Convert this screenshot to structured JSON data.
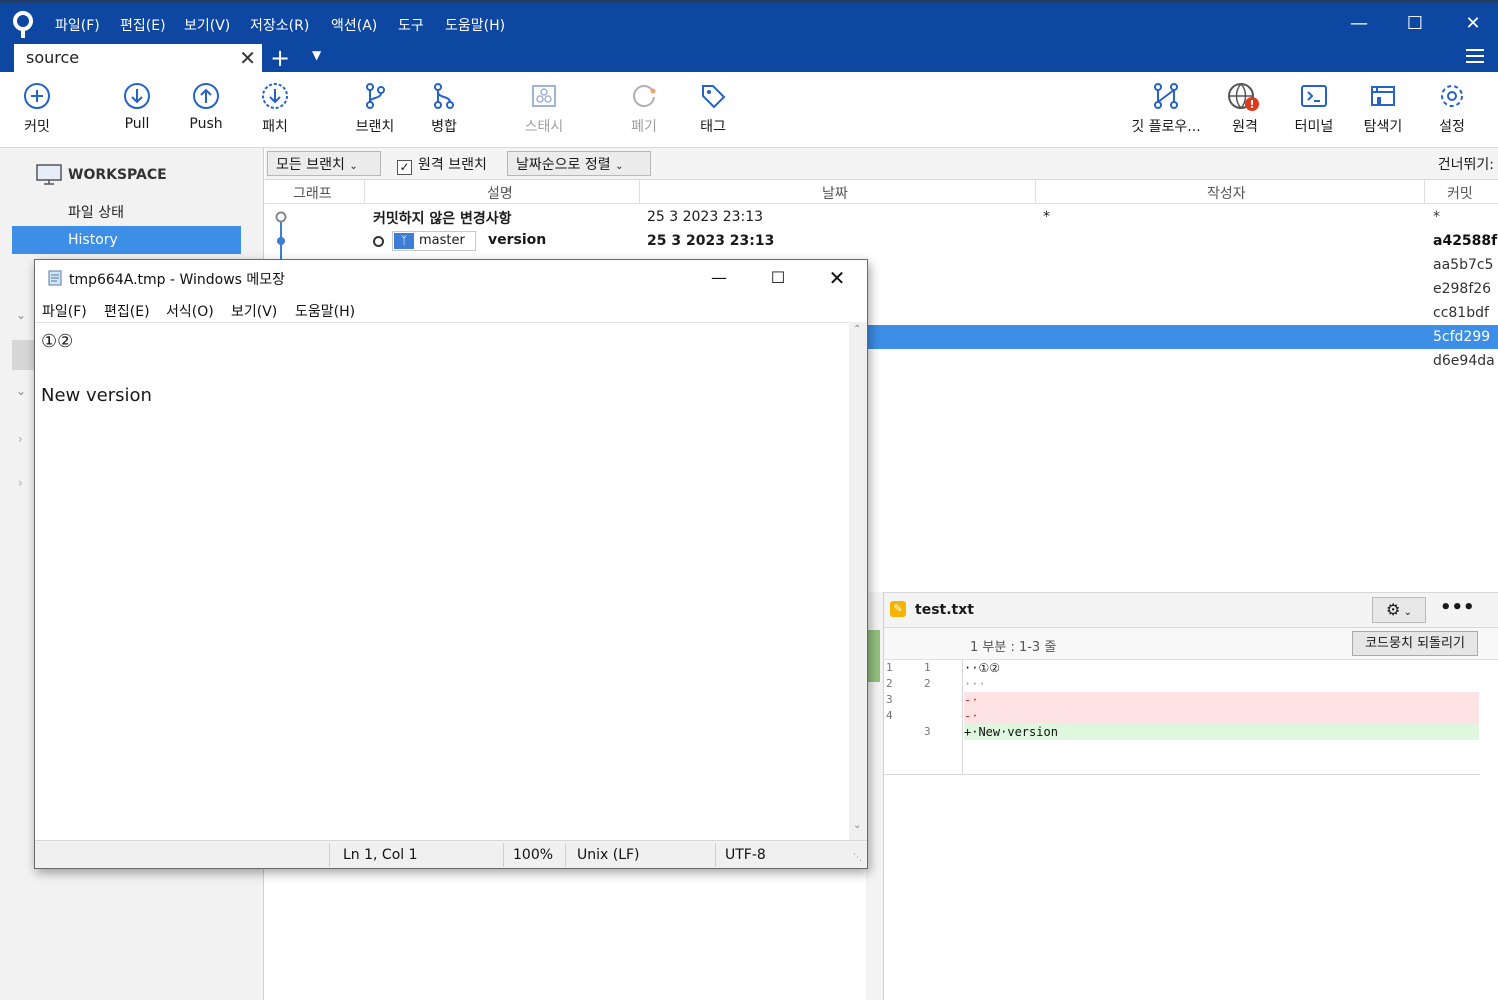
{
  "titlebar": {
    "menu": [
      "파일(F)",
      "편집(E)",
      "보기(V)",
      "저장소(R)",
      "액션(A)",
      "도구",
      "도움말(H)"
    ],
    "bg": "#0d47a1"
  },
  "tab": {
    "label": "source"
  },
  "toolbar": {
    "commit": "커밋",
    "pull": "Pull",
    "push": "Push",
    "patch": "패치",
    "branch": "브랜치",
    "merge": "병합",
    "stash": "스태시",
    "discard": "폐기",
    "tag": "태그",
    "gitflow": "깃 플로우...",
    "remote": "원격",
    "terminal": "터미널",
    "explorer": "탐색기",
    "settings": "설정"
  },
  "sidebar": {
    "workspace": "WORKSPACE",
    "file_status": "파일 상태",
    "history": "History"
  },
  "logbar": {
    "branches": "모든 브랜치",
    "remote_branches": "원격 브랜치",
    "sort": "날짜순으로 정렬",
    "skip": "건너뛰기:"
  },
  "columns": {
    "graph": "그래프",
    "description": "설명",
    "date": "날짜",
    "author": "작성자",
    "commit": "커밋"
  },
  "rows": {
    "uncommitted": {
      "desc": "커밋하지 않은 변경사항",
      "date": "25 3 2023 23:13",
      "author": "*",
      "commit": "*"
    },
    "head": {
      "branch": "master",
      "desc": "version",
      "date": "25 3 2023 23:13",
      "commit": "a42588f"
    },
    "hashes": [
      "aa5b7c5",
      "e298f26",
      "cc81bdf",
      "5cfd299",
      "d6e94da"
    ]
  },
  "diff": {
    "file": "test.txt",
    "hunk": "1 부분 : 1-3 줄",
    "revert": "코드뭉치 되돌리기",
    "lines": [
      {
        "old": "1",
        "new": "1",
        "text": "··①②",
        "type": "ctx"
      },
      {
        "old": "2",
        "new": "2",
        "text": "···",
        "type": "ctx"
      },
      {
        "old": "3",
        "new": "",
        "text": "-·",
        "type": "del"
      },
      {
        "old": "4",
        "new": "",
        "text": "-·",
        "type": "del"
      },
      {
        "old": "",
        "new": "3",
        "text": "+·New·version",
        "type": "add"
      }
    ]
  },
  "notepad": {
    "title": "tmp664A.tmp - Windows 메모장",
    "menu": [
      "파일(F)",
      "편집(E)",
      "서식(O)",
      "보기(V)",
      "도움말(H)"
    ],
    "line1": "①②",
    "line3": "New version",
    "status": {
      "pos": "Ln 1, Col 1",
      "zoom": "100%",
      "eol": "Unix (LF)",
      "enc": "UTF-8"
    }
  }
}
